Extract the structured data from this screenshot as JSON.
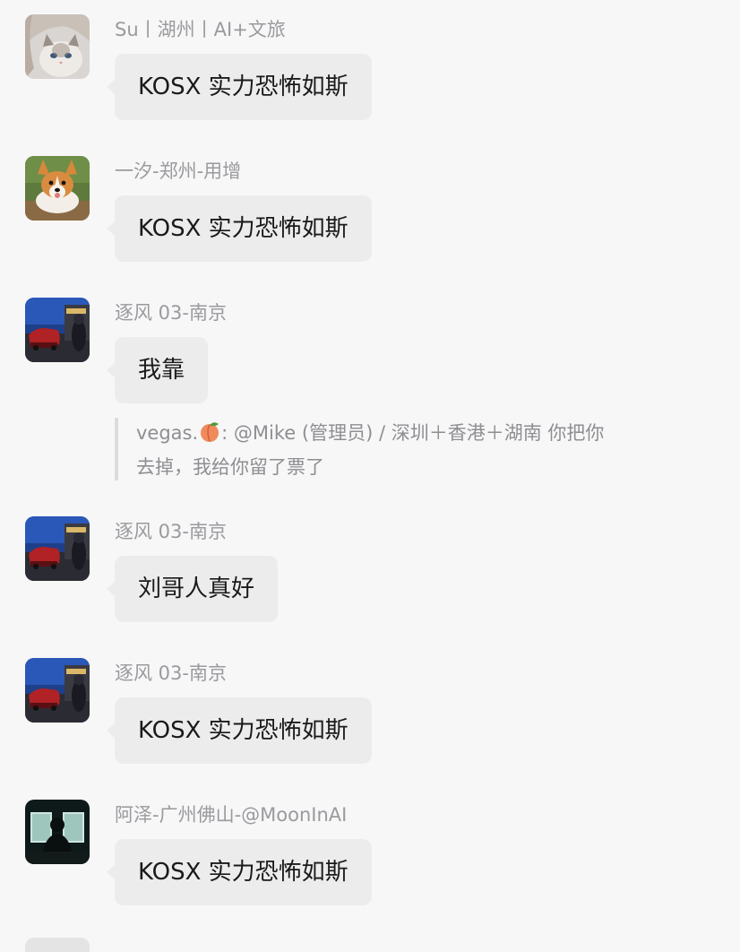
{
  "messages": [
    {
      "sender": "Su丨湖州丨AI+文旅",
      "text": "KOSX 实力恐怖如斯",
      "avatar": "cat-girl-avatar"
    },
    {
      "sender": "一汐-郑州-用增",
      "text": "KOSX 实力恐怖如斯",
      "avatar": "corgi-avatar"
    },
    {
      "sender": "逐风 03-南京",
      "text": "我靠",
      "avatar": "night-street-avatar"
    },
    {
      "sender": "逐风 03-南京",
      "text": "刘哥人真好",
      "avatar": "night-street-avatar"
    },
    {
      "sender": "逐风 03-南京",
      "text": "KOSX 实力恐怖如斯",
      "avatar": "night-street-avatar"
    },
    {
      "sender": "阿泽-广州佛山-@MoonInAI",
      "text": "KOSX 实力恐怖如斯",
      "avatar": "silhouette-avatar"
    }
  ],
  "quote": {
    "author": "vegas.",
    "line1_rest": ": @Mike (管理员) / 深圳＋香港＋湖南 你把你",
    "line2": "去掉，我给你留了票了",
    "emoji": "peach"
  },
  "colors": {
    "background": "#f7f7f7",
    "bubble": "#ececec",
    "sender_name": "#9a9a9f",
    "message_text": "#1a1a1a",
    "quote_text": "#8e8e93",
    "quote_bar": "#dcdcdc"
  }
}
